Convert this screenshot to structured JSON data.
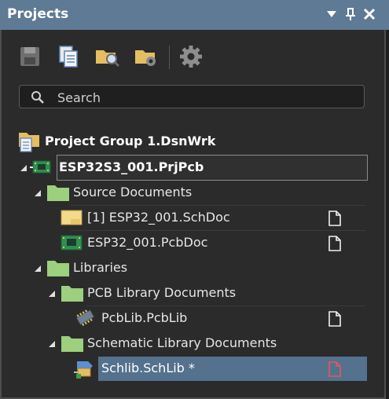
{
  "panel": {
    "title": "Projects",
    "controls": [
      "dropdown-icon",
      "pin-icon",
      "close-icon"
    ]
  },
  "toolbar": {
    "buttons": [
      "save-icon",
      "copy-documents-icon",
      "open-folder-search-icon",
      "folder-settings-icon",
      "gear-icon"
    ]
  },
  "search": {
    "placeholder": "Search",
    "value": ""
  },
  "tree": {
    "project_group": "Project Group 1.DsnWrk",
    "project": "ESP32S3_001.PrjPcb",
    "source_documents": "Source Documents",
    "schdoc": "[1] ESP32_001.SchDoc",
    "pcbdoc": "ESP32_001.PcbDoc",
    "libraries": "Libraries",
    "pcb_library_documents": "PCB Library Documents",
    "pcblib": "PcbLib.PcbLib",
    "schematic_library_documents": "Schematic Library Documents",
    "schlib": "Schlib.SchLib *"
  },
  "colors": {
    "titlebar": "#5e7a95",
    "selection": "#54718e",
    "folder": "#9ccf7e",
    "modified_doc": "#e05a5a"
  }
}
